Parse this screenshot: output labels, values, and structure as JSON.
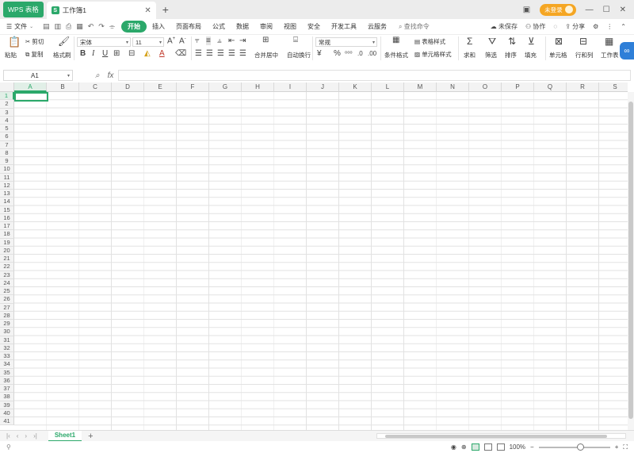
{
  "titlebar": {
    "app_tab": "WPS 表格",
    "doc_tab": "工作簿1",
    "doc_icon": "S",
    "login": "未登录"
  },
  "menubar": {
    "file": "文件",
    "tabs": [
      "开始",
      "插入",
      "页面布局",
      "公式",
      "数据",
      "审阅",
      "视图",
      "安全",
      "开发工具",
      "云服务"
    ],
    "active_tab": "开始",
    "search": "查找命令",
    "right": [
      "未保存",
      "协作",
      "分享"
    ]
  },
  "ribbon": {
    "paste": "粘贴",
    "cut": "剪切",
    "copy": "复制",
    "format_painter": "格式刷",
    "font_name": "宋体",
    "font_size": "11",
    "merge_center": "合并居中",
    "wrap_text": "自动换行",
    "number_format": "常规",
    "conditional_format": "条件格式",
    "table_style": "表格样式",
    "cell_style": "单元格样式",
    "sum": "求和",
    "filter": "筛选",
    "sort": "排序",
    "fill": "填充",
    "cell": "单元格",
    "row_col": "行和列",
    "worksheet": "工作表"
  },
  "formula": {
    "cell_ref": "A1",
    "fx": "fx",
    "value": ""
  },
  "grid": {
    "columns": [
      "A",
      "B",
      "C",
      "D",
      "E",
      "F",
      "G",
      "H",
      "I",
      "J",
      "K",
      "L",
      "M",
      "N",
      "O",
      "P",
      "Q",
      "R",
      "S"
    ],
    "rows": [
      "1",
      "2",
      "3",
      "4",
      "5",
      "6",
      "7",
      "8",
      "9",
      "10",
      "11",
      "12",
      "13",
      "14",
      "15",
      "16",
      "17",
      "18",
      "19",
      "20",
      "21",
      "22",
      "23",
      "24",
      "25",
      "26",
      "27",
      "28",
      "29",
      "30",
      "31",
      "32",
      "33",
      "34",
      "35",
      "36",
      "37",
      "38",
      "39",
      "40",
      "41"
    ],
    "selected_column": "A",
    "selected_row": "1"
  },
  "sheets": {
    "tabs": [
      "Sheet1"
    ],
    "active": "Sheet1"
  },
  "status": {
    "zoom": "100%"
  },
  "colors": {
    "accent": "#2ba86a",
    "login_pill": "#f5a623",
    "float_button": "#2f7fd8"
  }
}
